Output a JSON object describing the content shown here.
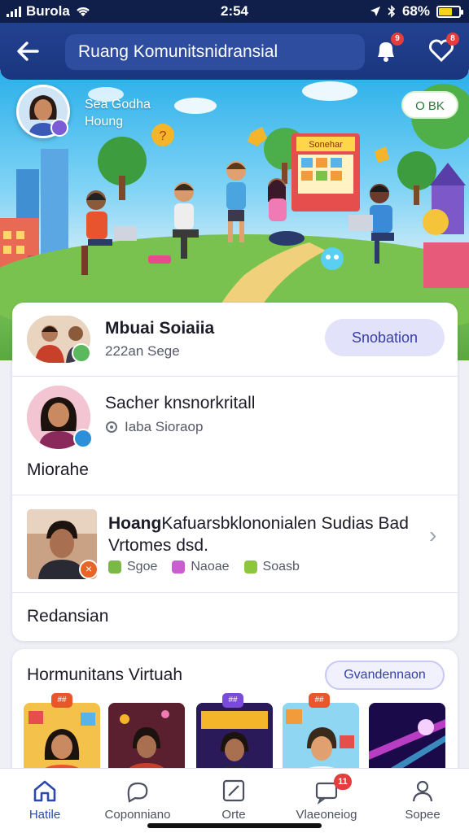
{
  "status_bar": {
    "carrier": "Burola",
    "time": "2:54",
    "battery": "68%"
  },
  "header": {
    "back_icon": "arrow-left-icon",
    "search_text": "Ruang Komunitsnidransial",
    "bell_badge": "9",
    "heart_badge": "8"
  },
  "banner": {
    "user_name": "Sea Godha",
    "user_sub": "Houng",
    "button_label": "O BK",
    "shop_sign": "Sonehar"
  },
  "card_main": {
    "row1": {
      "title": "Mbuai Soiaiia",
      "subtitle": "222an Sege",
      "button_label": "Snobation"
    },
    "row2": {
      "title": "Sacher knsnorkritall",
      "subtitle": "Iaba Sioraop"
    },
    "section1": "Miorahe",
    "row3": {
      "title_bold": "Hoang",
      "title_rest": "Kafuarsbklononialen Sudias Bad",
      "title_line2": "Vrtomes dsd.",
      "tags": [
        {
          "label": "Sgoe",
          "color": "#7ab848"
        },
        {
          "label": "Naoae",
          "color": "#c85ed0"
        },
        {
          "label": "Soasb",
          "color": "#8cc63e"
        }
      ]
    },
    "section2": "Redansian"
  },
  "card_comm": {
    "title": "Hormunitans Virtuah",
    "button_label": "Gvandennaon",
    "thumbs": [
      {
        "badge": "##",
        "bg": "#f4c14a"
      },
      {
        "badge": "",
        "bg": "#7a2f3a"
      },
      {
        "badge": "##",
        "bg": "#2b1a5a"
      },
      {
        "badge": "##",
        "bg": "#5cc4ee"
      },
      {
        "badge": "",
        "bg": "#3a1a7a"
      }
    ]
  },
  "tabbar": {
    "tabs": [
      {
        "label": "Hatile",
        "icon": "home-icon",
        "active": true
      },
      {
        "label": "Coponniano",
        "icon": "chat-bubble-icon",
        "active": false
      },
      {
        "label": "Orte",
        "icon": "edit-icon",
        "active": false
      },
      {
        "label": "Vlaeoneiog",
        "icon": "message-icon",
        "active": false,
        "badge": "11"
      },
      {
        "label": "Sopee",
        "icon": "profile-icon",
        "active": false
      }
    ]
  },
  "colors": {
    "header_bg": "#1a3680",
    "accent": "#3540a8",
    "pill_bg": "#e3e2fb"
  }
}
